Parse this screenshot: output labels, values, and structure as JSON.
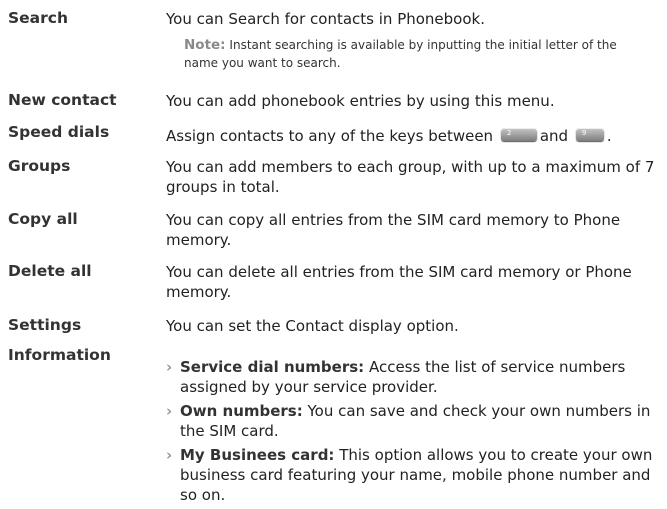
{
  "entries": [
    {
      "term": "Search",
      "desc": "You can Search for contacts in Phonebook."
    },
    {
      "term": "New contact",
      "desc": "You can add phonebook entries by using this menu."
    },
    {
      "term": "Speed dials",
      "desc_before": "Assign contacts to any of the keys between",
      "desc_middle": "and",
      "desc_after": "."
    },
    {
      "term": "Groups",
      "desc": "You can add members to each group, with up to a maximum of 7 groups in total."
    },
    {
      "term": "Copy all",
      "desc": "You can copy all entries from the SIM card memory to Phone memory."
    },
    {
      "term": "Delete all",
      "desc": "You can delete all entries from the SIM card memory or Phone memory."
    },
    {
      "term": "Settings",
      "desc": "You can set the Contact display option."
    },
    {
      "term": "Information"
    }
  ],
  "note": {
    "label": "Note:",
    "text": "Instant searching is available by inputting the initial letter of the name you want to search."
  },
  "keys": {
    "first": "2",
    "second": "9"
  },
  "information_items": [
    {
      "title": "Service dial numbers:",
      "text": "Access the list of service numbers assigned by your service provider."
    },
    {
      "title": "Own numbers:",
      "text": "You can save and check your own numbers in the SIM card."
    },
    {
      "title": "My Businees card:",
      "text": "This option allows you to create your own business card featuring your name, mobile phone number and so on."
    }
  ],
  "bullet_glyph": "›",
  "colors": {
    "text": "#222222",
    "note_label": "#8a8a8a",
    "keycap": "#9a9a9a"
  }
}
